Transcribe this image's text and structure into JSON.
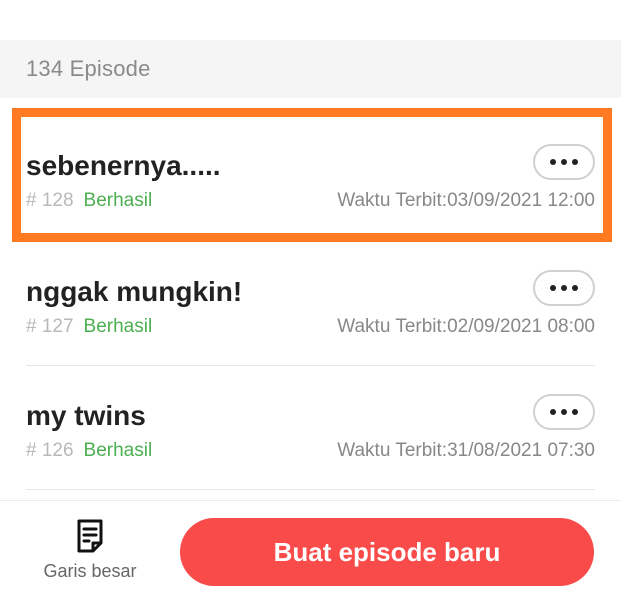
{
  "header": {
    "episode_count": "134 Episode"
  },
  "episodes": [
    {
      "title": "sebenernya.....",
      "number": "# 128",
      "status": "Berhasil",
      "publish_time": "Waktu Terbit:03/09/2021 12:00"
    },
    {
      "title": "nggak mungkin!",
      "number": "# 127",
      "status": "Berhasil",
      "publish_time": "Waktu Terbit:02/09/2021 08:00"
    },
    {
      "title": "my twins",
      "number": "# 126",
      "status": "Berhasil",
      "publish_time": "Waktu Terbit:31/08/2021 07:30"
    }
  ],
  "bottom": {
    "outline_label": "Garis besar",
    "outline_icon": "document-list-icon",
    "create_label": "Buat episode baru"
  },
  "colors": {
    "accent": "#fa4b4b",
    "status_success": "#4caf50",
    "highlight": "#ff7a20"
  }
}
